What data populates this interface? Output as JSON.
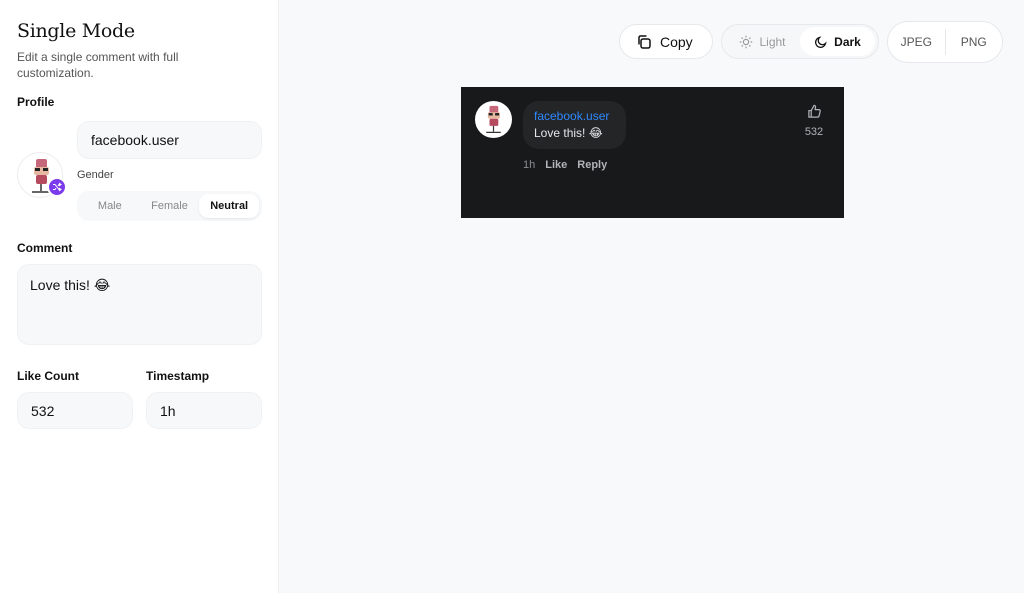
{
  "sidebar": {
    "title": "Single Mode",
    "subtitle": "Edit a single comment with full customization.",
    "profile_label": "Profile",
    "username": "facebook.user",
    "gender_label": "Gender",
    "gender_options": [
      "Male",
      "Female",
      "Neutral"
    ],
    "gender_selected": "Neutral",
    "comment_label": "Comment",
    "comment": "Love this! 😂",
    "like_count_label": "Like Count",
    "like_count": "532",
    "timestamp_label": "Timestamp",
    "timestamp": "1h"
  },
  "toolbar": {
    "copy_label": "Copy",
    "theme_options": [
      "Light",
      "Dark"
    ],
    "theme_selected": "Dark",
    "formats": [
      "JPEG",
      "PNG"
    ]
  },
  "preview": {
    "username": "facebook.user",
    "comment": "Love this! 😂",
    "time": "1h",
    "like_action": "Like",
    "reply_action": "Reply",
    "like_count": "532"
  },
  "colors": {
    "accent": "#7c3aed",
    "fb_blue": "#2e89ff",
    "preview_bg": "#18191a",
    "bubble_bg": "#242526"
  }
}
